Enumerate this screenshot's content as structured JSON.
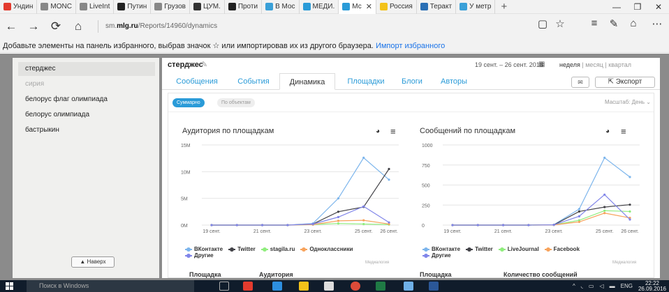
{
  "browser": {
    "tabs": [
      {
        "label": "Ундин",
        "icon": "yandex-icon",
        "color": "#e33b2e"
      },
      {
        "label": "MONC",
        "icon": "page-icon",
        "color": "#888888"
      },
      {
        "label": "LiveInt",
        "icon": "page-icon",
        "color": "#888888"
      },
      {
        "label": "Путин",
        "icon": "dark-square-icon",
        "color": "#222222"
      },
      {
        "label": "Грузов",
        "icon": "page-icon",
        "color": "#888888"
      },
      {
        "label": "ЦУМ.",
        "icon": "dark-square-icon",
        "color": "#333333"
      },
      {
        "label": "Проти",
        "icon": "dark-square-icon",
        "color": "#222222"
      },
      {
        "label": "В Мос",
        "icon": "mlg-icon",
        "color": "#3aa0d8"
      },
      {
        "label": "МЕДИ.",
        "icon": "mlg-icon",
        "color": "#2a9bd8"
      },
      {
        "label": "Мс",
        "icon": "mlg-icon",
        "color": "#2a9bd8",
        "active": true
      },
      {
        "label": "Россия",
        "icon": "flag-icon",
        "color": "#f3c21a"
      },
      {
        "label": "Теракт",
        "icon": "globe-icon",
        "color": "#2a6fb5"
      },
      {
        "label": "У метр",
        "icon": "mlg-icon",
        "color": "#3aa0d8"
      }
    ],
    "address_prefix": "sm.",
    "address_domain": "mlg.ru",
    "address_path": "/Reports/14960/dynamics",
    "favorites_text": "Добавьте элементы на панель избранного, выбрав значок ☆ или импортировав их из другого браузера.",
    "favorites_link": "Импорт избранного"
  },
  "sidebar": {
    "items": [
      {
        "label": "стерджес",
        "active": true
      },
      {
        "label": "сирия",
        "muted": true
      },
      {
        "label": "белорус флаг олимпиада"
      },
      {
        "label": "белорус олимпиада"
      },
      {
        "label": "бастрыкин"
      }
    ],
    "up_button": "Наверх"
  },
  "header": {
    "title": "стерджес",
    "date_range": "19 сент. – 26 сент. 2016",
    "period_week": "неделя",
    "period_rest": "| месяц | квартал"
  },
  "tabs": [
    "Сообщения",
    "События",
    "Динамика",
    "Площадки",
    "Блоги",
    "Авторы"
  ],
  "active_tab": "Динамика",
  "export_label": "Экспорт",
  "toggle": {
    "on": "Суммарно",
    "off": "По объектам"
  },
  "scale_label": "Масштаб: День",
  "credit": "Медиалогия",
  "chart_data": [
    {
      "type": "line",
      "title": "Аудитория по площадкам",
      "x": [
        "19 сент.",
        "20 сент.",
        "21 сент.",
        "22 сент.",
        "23 сент.",
        "24 сент.",
        "25 сент.",
        "26 сент."
      ],
      "xticks": [
        "19 сент.",
        "21 сент.",
        "23 сент.",
        "25 сент.",
        "26 сент."
      ],
      "yticks": [
        "0M",
        "5M",
        "10M",
        "15M"
      ],
      "ylim": [
        0,
        15
      ],
      "series": [
        {
          "name": "ВКонтакте",
          "color": "#7cb5ec",
          "values": [
            0,
            0,
            0,
            0,
            0.3,
            5,
            12.6,
            8.5
          ]
        },
        {
          "name": "Twitter",
          "color": "#434348",
          "values": [
            0,
            0,
            0,
            0,
            0.2,
            2.5,
            3.4,
            10.5
          ]
        },
        {
          "name": "stagila.ru",
          "color": "#90ed7d",
          "values": [
            0,
            0,
            0,
            0,
            0.1,
            0.3,
            0.2,
            0.1
          ]
        },
        {
          "name": "Одноклассники",
          "color": "#f7a35c",
          "values": [
            0,
            0,
            0,
            0,
            0.1,
            0.8,
            0.9,
            0.2
          ]
        },
        {
          "name": "Другие",
          "color": "#8085e9",
          "values": [
            0,
            0,
            0,
            0,
            0.2,
            1.5,
            3.5,
            0.5
          ]
        }
      ],
      "table_headers": [
        "Площадка",
        "Аудитория"
      ]
    },
    {
      "type": "line",
      "title": "Сообщений по площадкам",
      "x": [
        "19 сент.",
        "20 сент.",
        "21 сент.",
        "22 сент.",
        "23 сент.",
        "24 сент.",
        "25 сент.",
        "26 сент."
      ],
      "xticks": [
        "19 сент.",
        "21 сент.",
        "23 сент.",
        "25 сент.",
        "26 сент."
      ],
      "yticks": [
        "0",
        "250",
        "500",
        "750",
        "1000"
      ],
      "ylim": [
        0,
        1000
      ],
      "series": [
        {
          "name": "ВКонтакте",
          "color": "#7cb5ec",
          "values": [
            0,
            0,
            0,
            0,
            5,
            200,
            840,
            600
          ]
        },
        {
          "name": "Twitter",
          "color": "#434348",
          "values": [
            0,
            0,
            0,
            0,
            3,
            170,
            225,
            255
          ]
        },
        {
          "name": "LiveJournal",
          "color": "#90ed7d",
          "values": [
            0,
            0,
            0,
            0,
            2,
            60,
            180,
            170
          ]
        },
        {
          "name": "Facebook",
          "color": "#f7a35c",
          "values": [
            0,
            0,
            0,
            0,
            2,
            40,
            150,
            90
          ]
        },
        {
          "name": "Другие",
          "color": "#8085e9",
          "values": [
            0,
            0,
            0,
            0,
            3,
            110,
            380,
            70
          ]
        }
      ],
      "table_headers": [
        "Площадка",
        "Количество сообщений"
      ]
    }
  ],
  "taskbar": {
    "search_placeholder": "Поиск в Windows",
    "lang": "ENG",
    "time": "22:22",
    "date": "26.09.2016"
  }
}
